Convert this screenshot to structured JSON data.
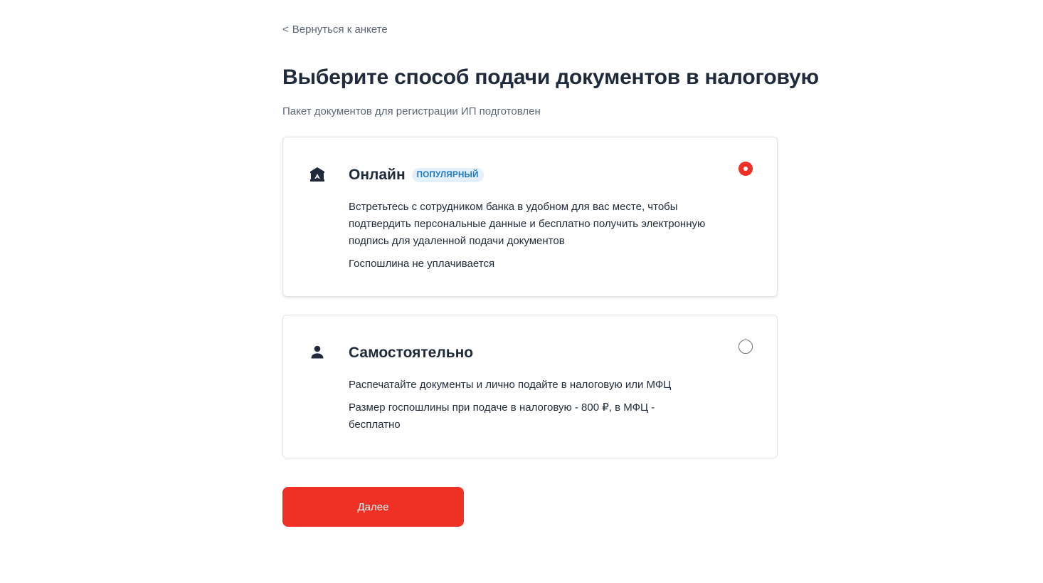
{
  "back_link": {
    "chevron": "<",
    "label": "Вернуться к анкете"
  },
  "page": {
    "title": "Выберите способ подачи документов в налоговую",
    "subtitle": "Пакет документов для регистрации ИП подготовлен"
  },
  "options": [
    {
      "icon": "bank-icon",
      "title": "Онлайн",
      "badge": "ПОПУЛЯРНЫЙ",
      "description": "Встретьтесь с сотрудником банка в удобном для вас месте, чтобы подтвердить персональные данные и бесплатно получить электронную подпись для удаленной подачи документов",
      "fee": "Госпошлина не уплачивается",
      "selected": true
    },
    {
      "icon": "person-icon",
      "title": "Самостоятельно",
      "description": "Распечатайте документы и лично подайте в налоговую или МФЦ",
      "fee": "Размер госпошлины при подаче в налоговую - 800 ₽, в МФЦ - бесплатно",
      "selected": false
    }
  ],
  "next_button": {
    "label": "Далее"
  },
  "colors": {
    "accent": "#ee3124",
    "badge_bg": "#e3f0fb",
    "badge_text": "#1a76c8",
    "text_primary": "#1f2b3a",
    "text_secondary": "#5b6677",
    "card_border": "#dfe3e8"
  }
}
